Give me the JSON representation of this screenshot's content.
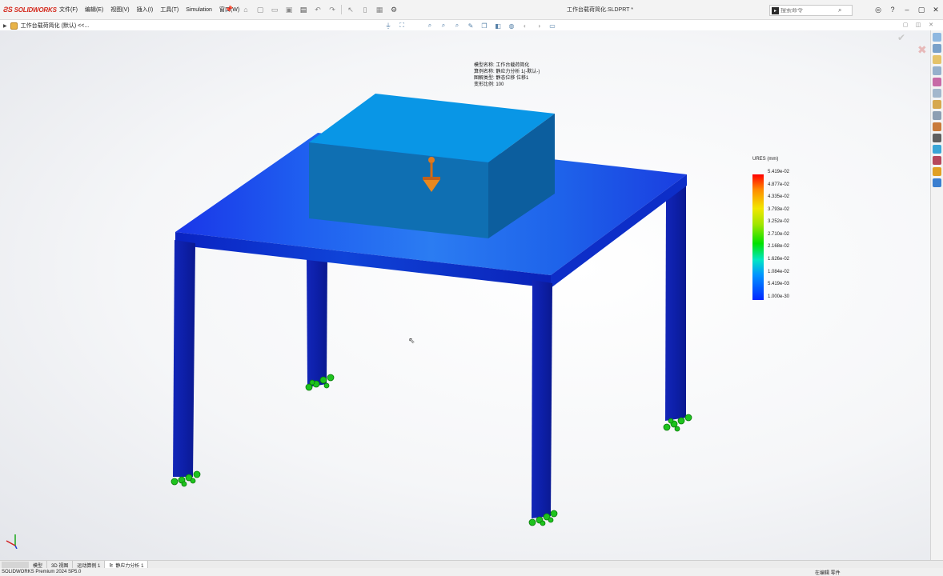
{
  "app": {
    "brand": "SOLIDWORKS",
    "document_title": "工作台载荷简化.SLDPRT *"
  },
  "menus": [
    "文件(F)",
    "编辑(E)",
    "视图(V)",
    "插入(I)",
    "工具(T)",
    "Simulation",
    "窗口(W)"
  ],
  "search": {
    "placeholder": "搜索命令"
  },
  "tree": {
    "root_label": "工作台载荷简化 (默认) <<..."
  },
  "plot_info": {
    "model_name": "模型名称: 工作台载荷简化",
    "study_name": "算例名称: 静应力分析 1(-默认-)",
    "plot_type": "图解类型: 静态位移 位移1",
    "deformation_scale": "变形比例: 100"
  },
  "legend": {
    "title": "URES (mm)",
    "ticks": [
      "5.419e-02",
      "4.877e-02",
      "4.335e-02",
      "3.793e-02",
      "3.252e-02",
      "2.710e-02",
      "2.168e-02",
      "1.626e-02",
      "1.084e-02",
      "5.419e-03",
      "1.000e-30"
    ],
    "max": 0.05419,
    "min": 1e-30
  },
  "tabs": [
    {
      "label": "模型",
      "active": false
    },
    {
      "label": "3D 视图",
      "active": false
    },
    {
      "label": "运动算例 1",
      "active": false
    },
    {
      "label": "静应力分析 1",
      "active": true
    }
  ],
  "status": {
    "left": "SOLIDWORKS Premium 2024 SP5.0",
    "right": "在编辑 零件"
  },
  "colors": {
    "brand_red": "#d52b1e",
    "deform_max": "#ff0000",
    "deform_min": "#0026ff",
    "fixture_green": "#1ec31e",
    "load_arrow": "#e07a1e"
  }
}
